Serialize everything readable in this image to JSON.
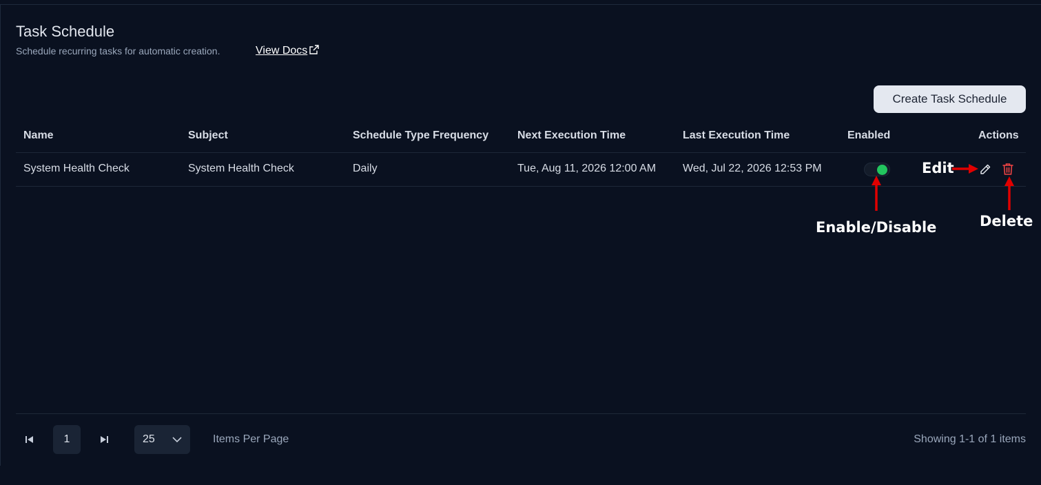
{
  "header": {
    "title": "Task Schedule",
    "subtitle": "Schedule recurring tasks for automatic creation.",
    "docs_link": "View Docs"
  },
  "toolbar": {
    "create_label": "Create Task Schedule"
  },
  "table": {
    "columns": [
      "Name",
      "Subject",
      "Schedule Type Frequency",
      "Next Execution Time",
      "Last Execution Time",
      "Enabled",
      "Actions"
    ],
    "rows": [
      {
        "name": "System Health Check",
        "subject": "System Health Check",
        "frequency": "Daily",
        "next_execution": "Tue, Aug 11, 2026 12:00 AM",
        "last_execution": "Wed, Jul 22, 2026 12:53 PM",
        "enabled": true
      }
    ]
  },
  "annotations": {
    "edit": "Edit",
    "enable_disable": "Enable/Disable",
    "delete": "Delete"
  },
  "pagination": {
    "current_page": "1",
    "per_page": "25",
    "per_page_label": "Items Per Page",
    "showing": "Showing 1-1 of 1 items"
  },
  "colors": {
    "background": "#0a1120",
    "toggle_on": "#22c55e",
    "delete": "#ef4444",
    "annotation_arrow": "#e00000"
  },
  "icons": {
    "external_link": "external-link-icon",
    "edit": "pencil-icon",
    "delete": "trash-icon",
    "first_page": "first-page-icon",
    "last_page": "last-page-icon",
    "dropdown": "chevron-down-icon"
  }
}
